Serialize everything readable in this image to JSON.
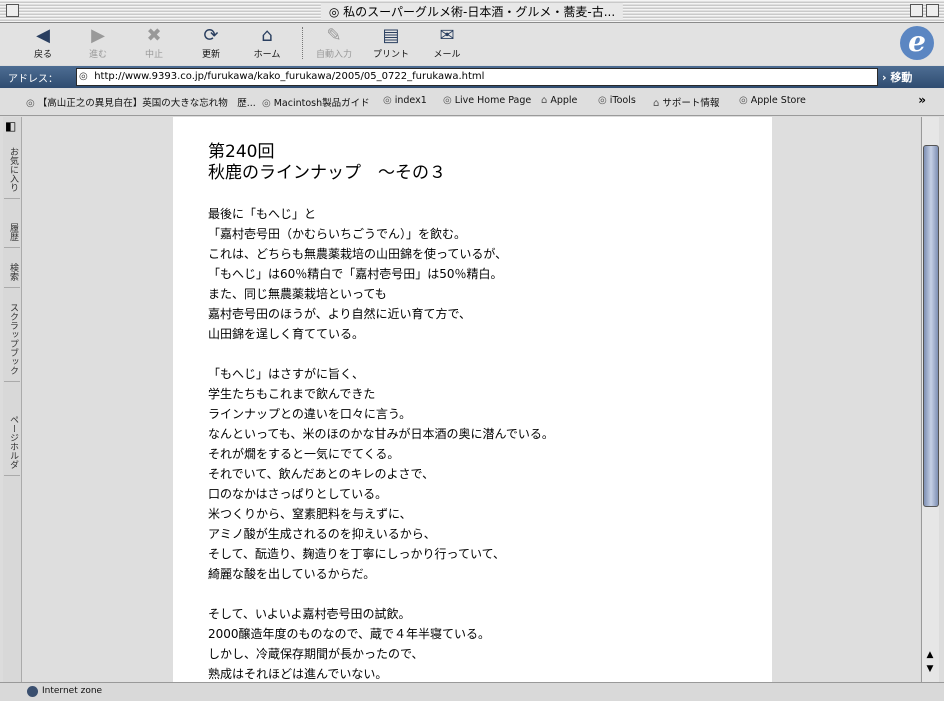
{
  "window": {
    "title": "私のスーパーグルメ術-日本酒・グルメ・蕎麦-古..."
  },
  "toolbar": {
    "back": "戻る",
    "forward": "進む",
    "stop": "中止",
    "refresh": "更新",
    "home": "ホーム",
    "autofill": "自動入力",
    "print": "プリント",
    "mail": "メール"
  },
  "address": {
    "label": "アドレス：",
    "url": "http://www.9393.co.jp/furukawa/kako_furukawa/2005/05_0722_furukawa.html",
    "go": "移動"
  },
  "favorites": [
    "【高山正之の異見自在】英国の大きな忘れ物　歴...",
    "Macintosh製品ガイド",
    "index1",
    "Live Home Page",
    "Apple",
    "iTools",
    "サポート情報",
    "Apple Store"
  ],
  "side_tabs": [
    "お気に入り",
    "履歴",
    "検索",
    "スクラップブック",
    "ページホルダ"
  ],
  "article": {
    "heading_1": "第240回",
    "heading_2": "秋鹿のラインナップ　～その３",
    "lines": [
      "最後に「もへじ」と",
      "「嘉村壱号田（かむらいちごうでん）」を飲む。",
      "これは、どちらも無農薬栽培の山田錦を使っているが、",
      "「もへじ」は60％精白で「嘉村壱号田」は50％精白。",
      "また、同じ無農薬栽培といっても",
      "嘉村壱号田のほうが、より自然に近い育て方で、",
      "山田錦を逞しく育てている。",
      "",
      "「もへじ」はさすがに旨く、",
      "学生たちもこれまで飲んできた",
      "ラインナップとの違いを口々に言う。",
      "なんといっても、米のほのかな甘みが日本酒の奥に潜んでいる。",
      "それが燗をすると一気にでてくる。",
      "それでいて、飲んだあとのキレのよさで、",
      "口のなかはさっぱりとしている。",
      "米つくりから、窒素肥料を与えずに、",
      "アミノ酸が生成されるのを抑えいるから、",
      "そして、酛造り、麹造りを丁寧にしっかり行っていて、",
      "綺麗な酸を出しているからだ。",
      "",
      "そして、いよいよ嘉村壱号田の試飲。",
      "2000醸造年度のものなので、蔵で４年半寝ている。",
      "しかし、冷蔵保存期間が長かったので、",
      "熟成はそれほどは進んでいない。"
    ]
  },
  "status": {
    "zone": "Internet zone"
  }
}
